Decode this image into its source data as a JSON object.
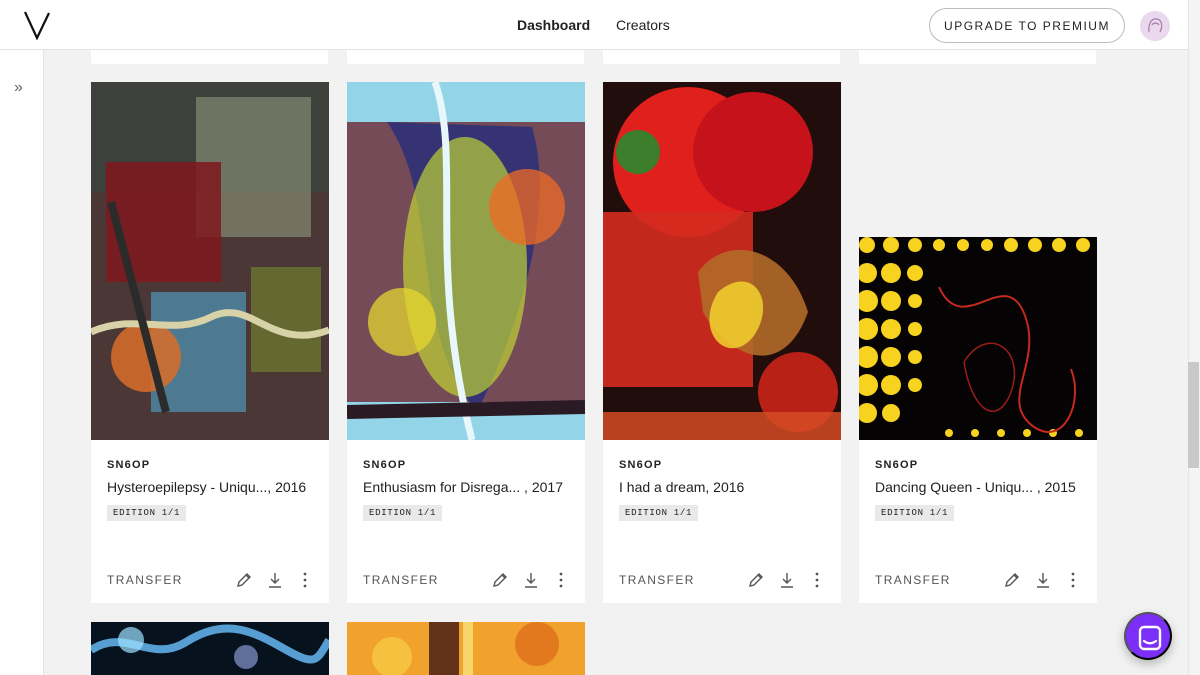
{
  "header": {
    "nav": [
      {
        "label": "Dashboard",
        "active": true
      },
      {
        "label": "Creators",
        "active": false
      }
    ],
    "upgrade_label": "UPGRADE TO PREMIUM"
  },
  "artworks": [
    {
      "artist": "SN6OP",
      "title": "Hysteroepilepsy - Uniqu..., 2016",
      "edition": "EDITION 1/1",
      "transfer": "TRANSFER"
    },
    {
      "artist": "SN6OP",
      "title": "Enthusiasm for Disrega... , 2017",
      "edition": "EDITION 1/1",
      "transfer": "TRANSFER"
    },
    {
      "artist": "SN6OP",
      "title": "I had a dream, 2016",
      "edition": "EDITION 1/1",
      "transfer": "TRANSFER"
    },
    {
      "artist": "SN6OP",
      "title": "Dancing Queen - Uniqu... , 2015",
      "edition": "EDITION 1/1",
      "transfer": "TRANSFER"
    }
  ],
  "icons": {
    "logo": "v-logo-icon",
    "sidebar": "double-chevron-right-icon",
    "edit": "pencil-icon",
    "download": "download-icon",
    "more": "more-vertical-icon",
    "chat": "chat-icon"
  },
  "colors": {
    "accent": "#7b2ff7",
    "edition_badge": "#e9e9e9",
    "background": "#f2f2f2"
  }
}
